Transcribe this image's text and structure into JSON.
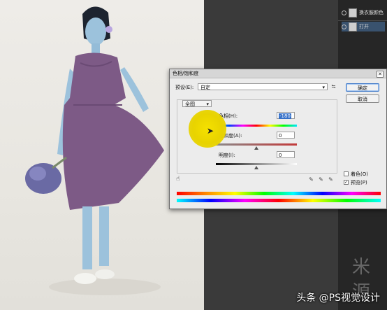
{
  "layers_panel": {
    "layers": [
      {
        "name": "换衣服颜色",
        "selected": false
      },
      {
        "name": "打开",
        "selected": true
      }
    ]
  },
  "dialog": {
    "title": "色相/饱和度",
    "preset_label": "预设(E):",
    "preset_value": "自定",
    "ok_label": "确定",
    "cancel_label": "取消",
    "channel_value": "全图",
    "hue_label": "色相(H):",
    "hue_value": "-180",
    "saturation_label": "饱和度(A):",
    "saturation_value": "0",
    "lightness_label": "明度(I):",
    "lightness_value": "0",
    "colorize_label": "着色(O)",
    "colorize_checked": false,
    "preview_label": "预览(P)",
    "preview_checked": true
  },
  "watermark": "头条 @PS视觉设计",
  "colors": {
    "selection": "#39526e",
    "cursor_highlight": "#f0dc00",
    "dress": "#7d5a86",
    "skin": "#9fc3dc"
  }
}
